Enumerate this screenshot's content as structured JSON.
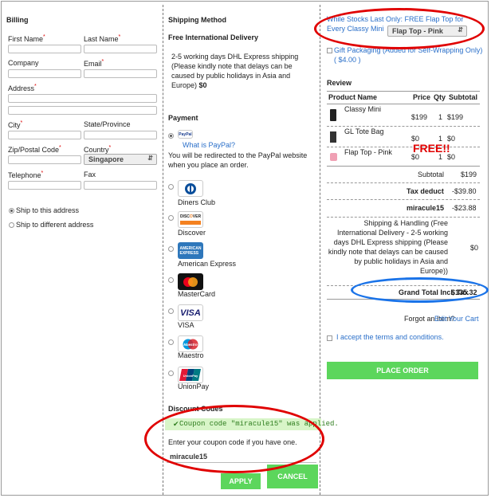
{
  "billing": {
    "title": "Billing",
    "first_name": "First Name",
    "last_name": "Last Name",
    "company": "Company",
    "email": "Email",
    "address": "Address",
    "city": "City",
    "state": "State/Province",
    "zip": "Zip/Postal Code",
    "country": "Country",
    "country_value": "Singapore",
    "telephone": "Telephone",
    "fax": "Fax",
    "ship_same": "Ship to this address",
    "ship_diff": "Ship to different address"
  },
  "shipping": {
    "title": "Shipping Method",
    "method": "Free International Delivery",
    "description": "2-5 working days DHL Express shipping (Please kindly note that delays can be caused by public holidays in Asia and Europe)",
    "price": "$0"
  },
  "payment": {
    "title": "Payment",
    "paypal_logo": "PayPal",
    "paypal_link": "What is PayPal?",
    "paypal_note": "You will be redirected to the PayPal website when you place an order.",
    "methods": [
      {
        "label": "Diners Club",
        "icon": "diners-club-icon"
      },
      {
        "label": "Discover",
        "icon": "discover-icon"
      },
      {
        "label": "American Express",
        "icon": "amex-icon"
      },
      {
        "label": "MasterCard",
        "icon": "mastercard-icon"
      },
      {
        "label": "VISA",
        "icon": "visa-icon"
      },
      {
        "label": "Maestro",
        "icon": "maestro-icon"
      },
      {
        "label": "UnionPay",
        "icon": "unionpay-icon"
      }
    ]
  },
  "discount": {
    "title": "Discount Codes",
    "applied_msg": "Coupon code \"miracule15\" was applied.",
    "prompt": "Enter your coupon code if you have one.",
    "code": "miracule15",
    "apply": "APPLY",
    "cancel": "CANCEL"
  },
  "promo": {
    "text": "While Stocks Last Only: FREE Flap Top for Every Classy Mini",
    "select": "Flap Top - Pink",
    "gift": "Gift Packaging (Added for Self-Wrapping Only) ( $4.00 )"
  },
  "review": {
    "title": "Review",
    "headers": [
      "Product Name",
      "Price",
      "Qty",
      "Subtotal"
    ],
    "items": [
      {
        "name": "Classy Mini",
        "price": "$199",
        "qty": "1",
        "subtotal": "$199"
      },
      {
        "name": "GL Tote Bag",
        "price": "$0",
        "qty": "1",
        "subtotal": "$0"
      },
      {
        "name": "Flap Top - Pink",
        "price": "$0",
        "qty": "1",
        "subtotal": "$0"
      }
    ],
    "free_note": "FREE!!",
    "subtotal_label": "Subtotal",
    "subtotal_value": "$199",
    "tax_label": "Tax deduct",
    "tax_value": "-$39.80",
    "coupon_label": "miracule15",
    "coupon_value": "-$23.88",
    "shipping_label": "Shipping & Handling (Free International Delivery - 2-5 working days DHL Express shipping (Please kindly note that delays can be caused by public holidays in Asia and Europe))",
    "shipping_value": "$0",
    "grand_label": "Grand Total Incl. Tax",
    "grand_value": "$135.32",
    "forgot": "Forgot an Item?",
    "edit_cart": "Edit Your Cart",
    "terms": "I accept the terms and conditions.",
    "place_order": "PLACE ORDER"
  },
  "colors": {
    "green": "#5cd65c",
    "link": "#2a6fc9",
    "annotation_red": "#e00000",
    "annotation_blue": "#1a73e8"
  }
}
